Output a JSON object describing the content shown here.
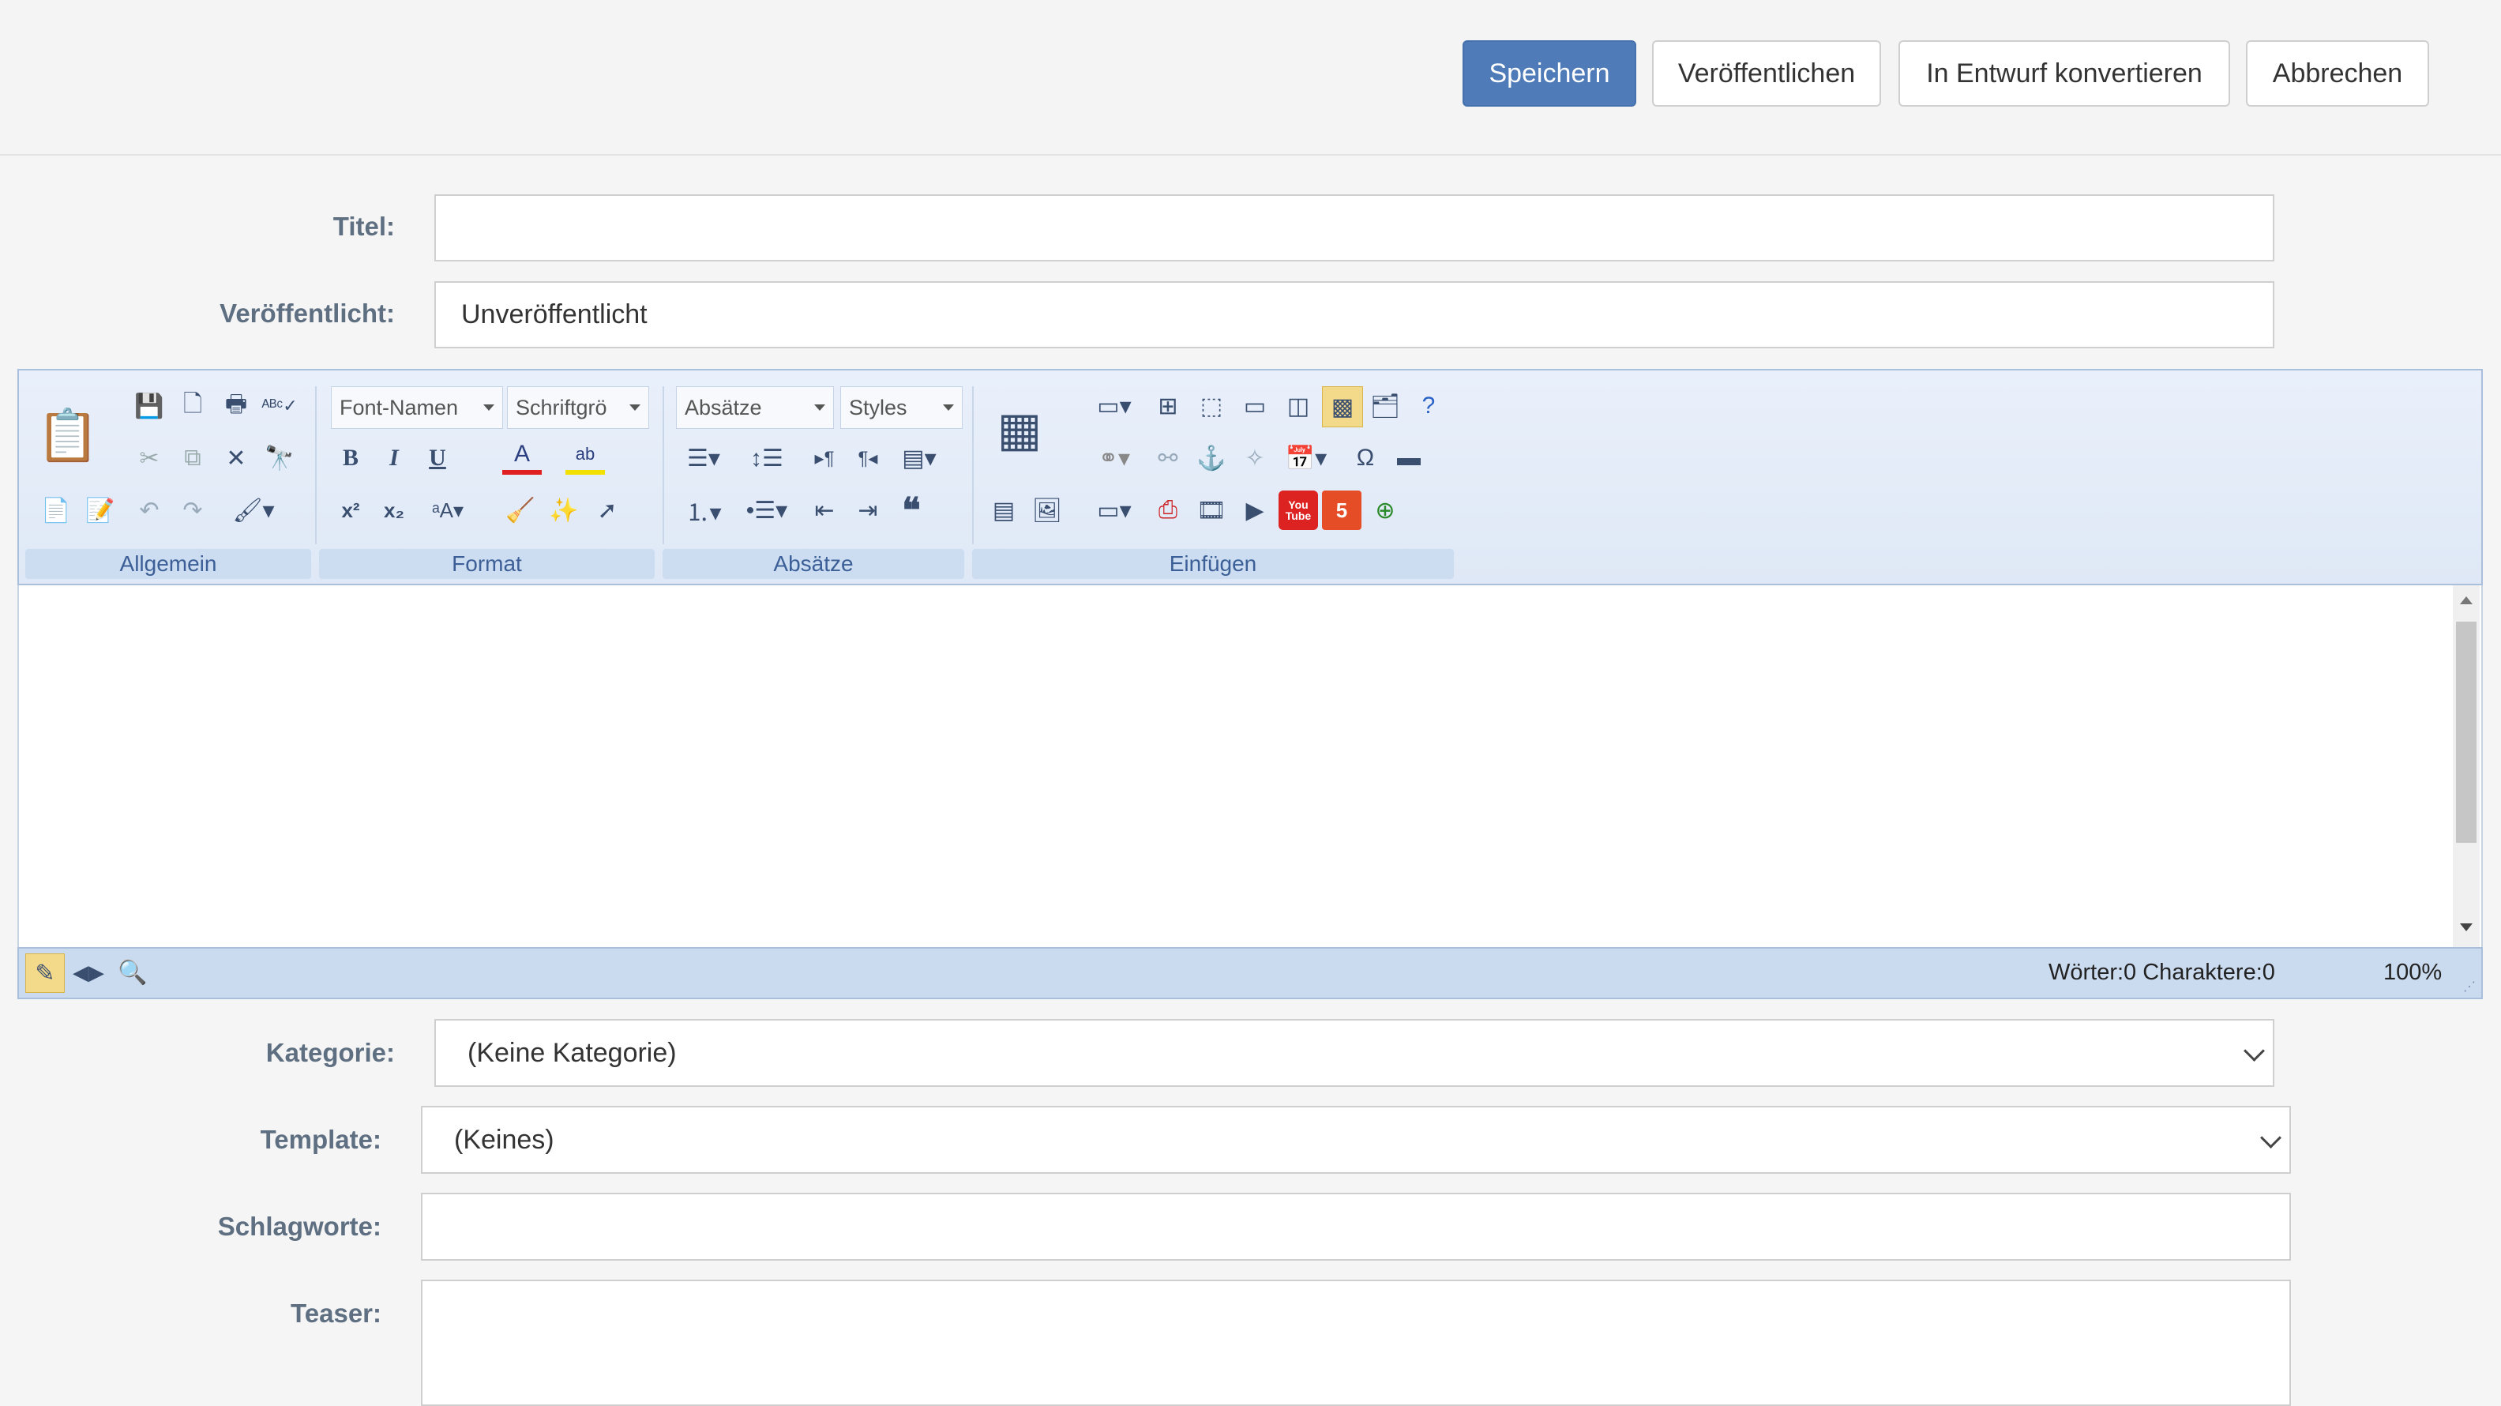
{
  "toolbar": {
    "save": "Speichern",
    "publish": "Veröffentlichen",
    "convert_draft": "In Entwurf konvertieren",
    "cancel": "Abbrechen",
    "accent": "#4f7bb8"
  },
  "form": {
    "title_label": "Titel:",
    "title_value": "",
    "published_label": "Veröffentlicht:",
    "published_value": "Unveröffentlicht",
    "category_label": "Kategorie:",
    "category_value": "(Keine Kategorie)",
    "template_label": "Template:",
    "template_value": "(Keines)",
    "tags_label": "Schlagworte:",
    "tags_value": "",
    "teaser_label": "Teaser:",
    "teaser_value": ""
  },
  "editor": {
    "font_name": "Font-Namen",
    "font_size": "Schriftgrö",
    "paragraph": "Absätze",
    "styles": "Styles",
    "groups": [
      "Allgemein",
      "Format",
      "Absätze",
      "Einfügen"
    ],
    "status_counts": "Wörter:0 Charaktere:0",
    "zoom": "100%",
    "buttons": {
      "bold": "B",
      "italic": "I",
      "underline": "U",
      "font_color": "A",
      "omega": "Ω",
      "quote": "❝",
      "superscript": "x²",
      "subscript": "x₂",
      "youtube": "You Tube",
      "html5": "5"
    }
  }
}
